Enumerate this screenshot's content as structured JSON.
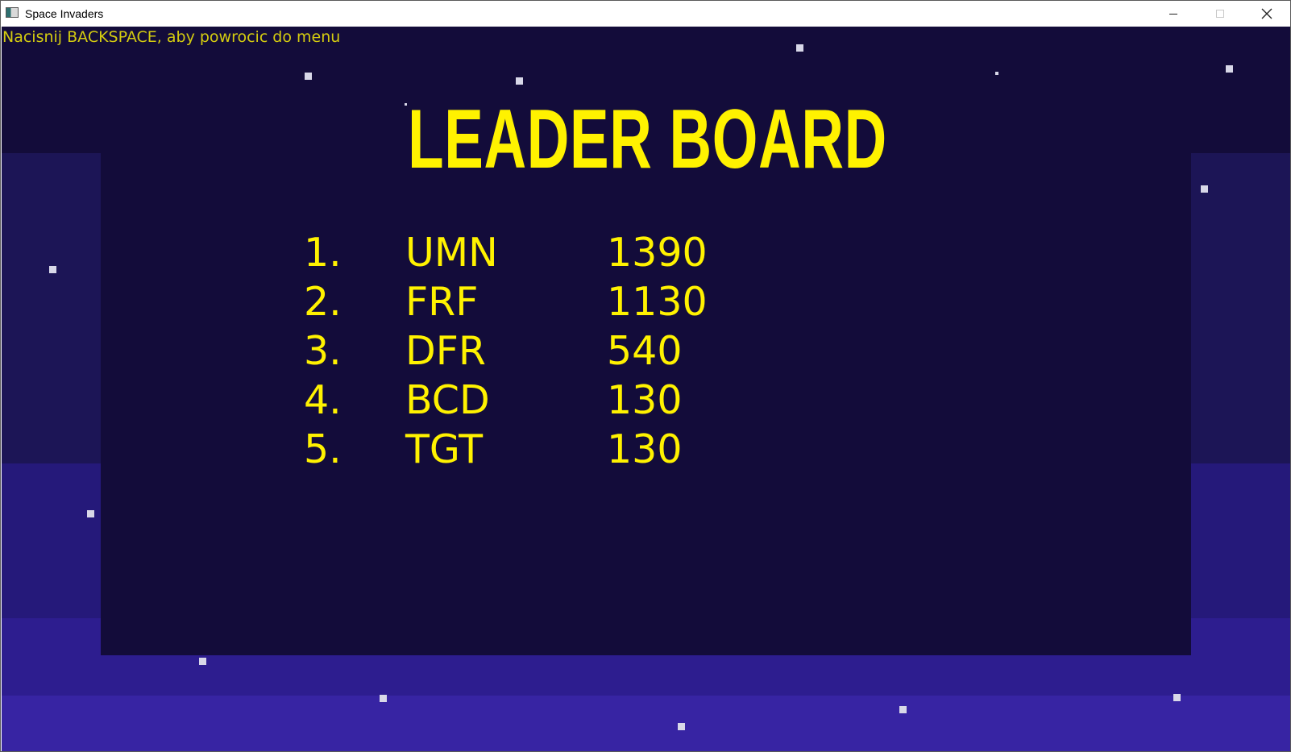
{
  "window": {
    "title": "Space Invaders",
    "icon": "app-window-icon",
    "controls": [
      "minimize-icon",
      "maximize-icon",
      "close-icon"
    ]
  },
  "game": {
    "hint": "Nacisnij BACKSPACE, aby powrocic do menu",
    "heading": "LEADER BOARD",
    "leaderboard": [
      {
        "rank": "1.",
        "name": "UMN",
        "score": "1390"
      },
      {
        "rank": "2.",
        "name": "FRF",
        "score": "1130"
      },
      {
        "rank": "3.",
        "name": "DFR",
        "score": "540"
      },
      {
        "rank": "4.",
        "name": "BCD",
        "score": "130"
      },
      {
        "rank": "5.",
        "name": "TGT",
        "score": "130"
      }
    ]
  },
  "colors": {
    "background": "#130c3a",
    "text_accent": "#fff200",
    "hint_text": "#d4cc10",
    "star": "#d8d8e8"
  }
}
